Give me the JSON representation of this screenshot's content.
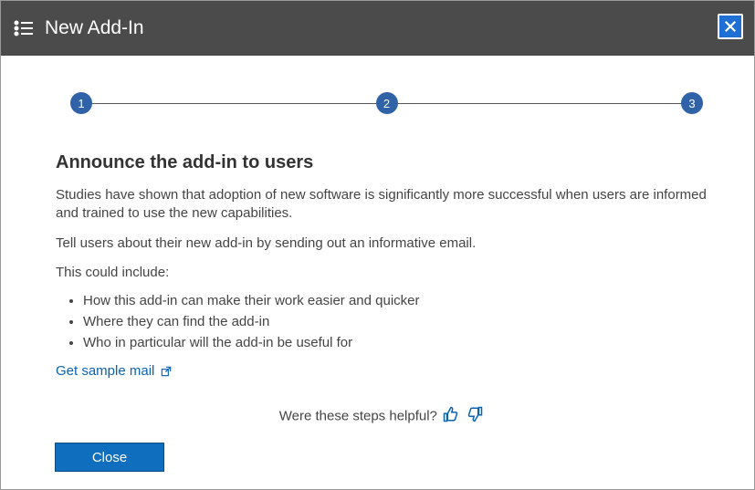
{
  "header": {
    "title": "New Add-In"
  },
  "wizard": {
    "step1": "1",
    "step2": "2",
    "step3": "3"
  },
  "page": {
    "heading": "Announce the add-in to users",
    "p1": "Studies have shown that adoption of new software is significantly more successful when users are informed and trained to use the new capabilities.",
    "p2": "Tell users about their new add-in by sending out an informative email.",
    "p3": "This could include:",
    "bullets": [
      "How this add-in can make their work easier and quicker",
      "Where they can find the add-in",
      "Who in particular will the add-in be useful for"
    ],
    "link": "Get sample mail",
    "feedback": "Were these steps helpful?"
  },
  "buttons": {
    "close": "Close"
  }
}
